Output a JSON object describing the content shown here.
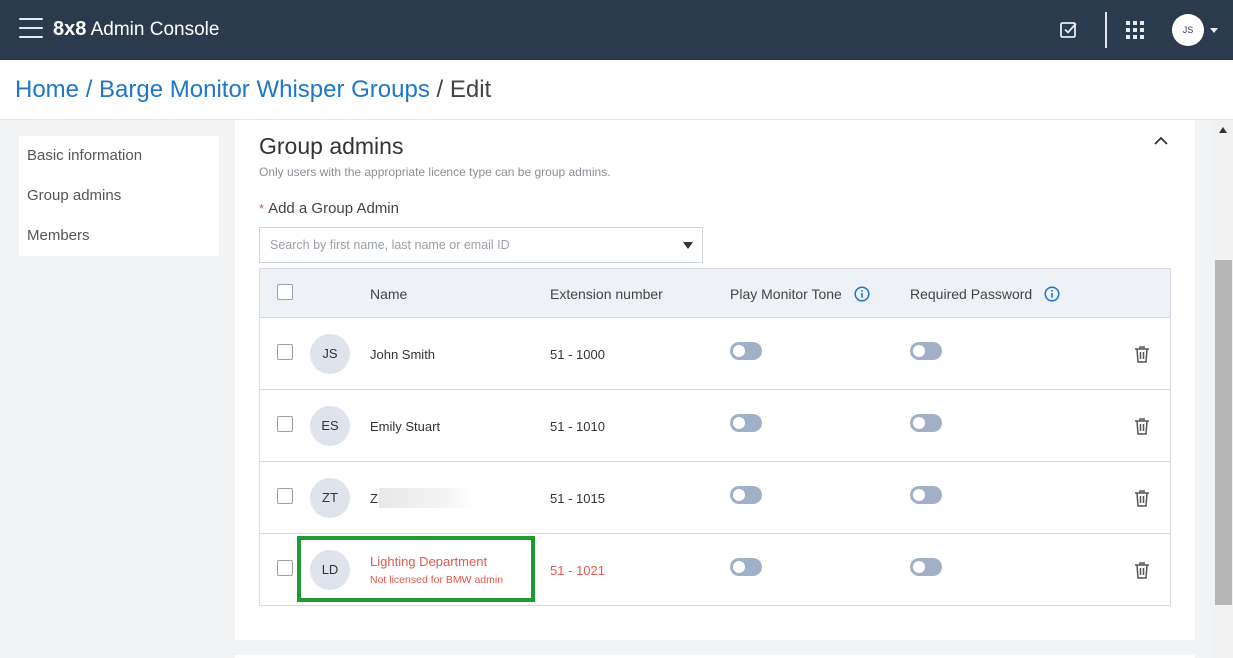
{
  "app": {
    "brand_bold": "8x8",
    "brand_title": "Admin Console",
    "user_initials": "JS"
  },
  "breadcrumb": {
    "home": "Home",
    "separator": "/",
    "section": "Barge Monitor Whisper Groups",
    "current": "Edit"
  },
  "sidenav": {
    "items": [
      {
        "label": "Basic information"
      },
      {
        "label": "Group admins"
      },
      {
        "label": "Members"
      }
    ]
  },
  "section": {
    "title": "Group admins",
    "subtitle": "Only users with the appropriate licence type can be group admins.",
    "field_label": "Add a Group Admin",
    "required_mark": "*",
    "search_placeholder": "Search by first name, last name or email ID"
  },
  "table": {
    "headers": {
      "name": "Name",
      "extension": "Extension number",
      "play_monitor_tone": "Play Monitor Tone",
      "required_password": "Required Password"
    },
    "rows": [
      {
        "initials": "JS",
        "name": "John Smith",
        "extension": "51 - 1000",
        "play_tone": false,
        "password": false
      },
      {
        "initials": "ES",
        "name": "Emily Stuart",
        "extension": "51 - 1010",
        "play_tone": false,
        "password": false
      },
      {
        "initials": "ZT",
        "name": "Z",
        "extension": "51 - 1015",
        "play_tone": false,
        "password": false
      },
      {
        "initials": "LD",
        "name": "Lighting Department",
        "note": "Not licensed for BMW admin",
        "extension": "51 - 1021",
        "play_tone": false,
        "password": false
      }
    ]
  },
  "colors": {
    "topbar": "#2c3a4d",
    "link": "#1f77c8",
    "error": "#e05a4e",
    "highlight": "#1e9a32",
    "toggle_off": "#9fb0c8"
  }
}
